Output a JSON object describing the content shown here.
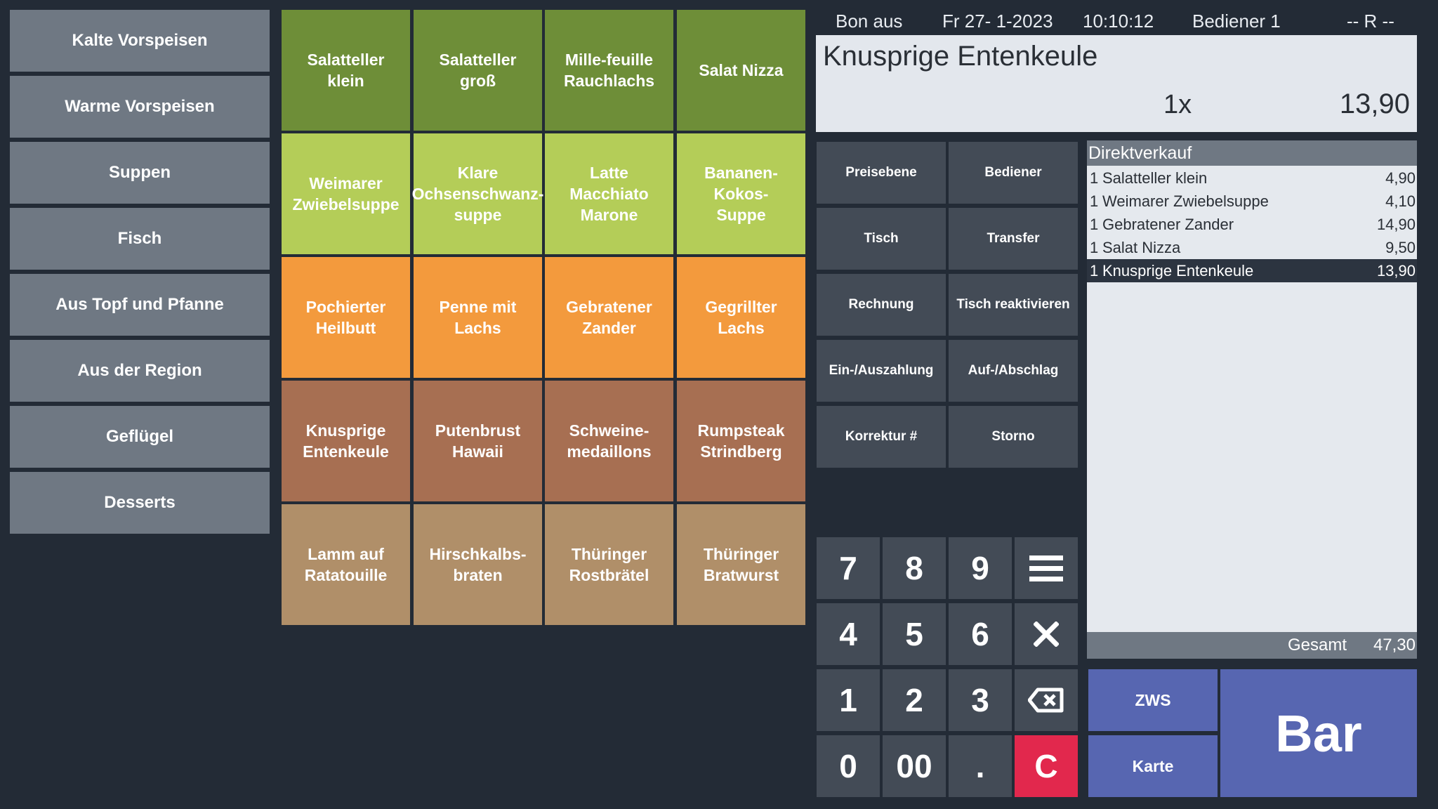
{
  "categories": [
    "Kalte Vorspeisen",
    "Warme Vorspeisen",
    "Suppen",
    "Fisch",
    "Aus Topf und Pfanne",
    "Aus der Region",
    "Geflügel",
    "Desserts"
  ],
  "products": [
    {
      "label": "Salatteller\nklein",
      "color": "#6e8e38"
    },
    {
      "label": "Salatteller\ngroß",
      "color": "#6e8e38"
    },
    {
      "label": "Mille-feuille\nRauchlachs",
      "color": "#6e8e38"
    },
    {
      "label": "Salat Nizza",
      "color": "#6e8e38"
    },
    {
      "label": "Weimarer\nZwiebelsuppe",
      "color": "#b4cd58"
    },
    {
      "label": "Klare\nOchsenschwanz-\nsuppe",
      "color": "#b4cd58"
    },
    {
      "label": "Latte\nMacchiato\nMarone",
      "color": "#b4cd58"
    },
    {
      "label": "Bananen-\nKokos-\nSuppe",
      "color": "#b4cd58"
    },
    {
      "label": "Pochierter\nHeilbutt",
      "color": "#f39a3d"
    },
    {
      "label": "Penne mit\nLachs",
      "color": "#f39a3d"
    },
    {
      "label": "Gebratener\nZander",
      "color": "#f39a3d"
    },
    {
      "label": "Gegrillter\nLachs",
      "color": "#f39a3d"
    },
    {
      "label": "Knusprige\nEntenkeule",
      "color": "#a76f52"
    },
    {
      "label": "Putenbrust\nHawaii",
      "color": "#a76f52"
    },
    {
      "label": "Schweine-\nmedaillons",
      "color": "#a76f52"
    },
    {
      "label": "Rumpsteak\nStrindberg",
      "color": "#a76f52"
    },
    {
      "label": "Lamm auf\nRatatouille",
      "color": "#b08f69"
    },
    {
      "label": "Hirschkalbs-\nbraten",
      "color": "#b08f69"
    },
    {
      "label": "Thüringer\nRostbrätel",
      "color": "#b08f69"
    },
    {
      "label": "Thüringer\nBratwurst",
      "color": "#b08f69"
    }
  ],
  "header": {
    "bon": "Bon aus",
    "date": "Fr  27- 1-2023",
    "time": "10:10:12",
    "operator": "Bediener 1",
    "mode": "-- R --"
  },
  "display": {
    "item": "Knusprige Entenkeule",
    "qty": "1x",
    "price": "13,90"
  },
  "functions": [
    "Preisebene",
    "Bediener",
    "Tisch",
    "Transfer",
    "Rechnung",
    "Tisch reaktivieren",
    "Ein-/Auszahlung",
    "Auf-/Abschlag",
    "Korrektur #",
    "Storno"
  ],
  "receipt": {
    "title": "Direktverkauf",
    "items": [
      {
        "qty": "1",
        "name": "Salatteller klein",
        "price": "4,90"
      },
      {
        "qty": "1",
        "name": "Weimarer Zwiebelsuppe",
        "price": "4,10"
      },
      {
        "qty": "1",
        "name": "Gebratener Zander",
        "price": "14,90"
      },
      {
        "qty": "1",
        "name": "Salat Nizza",
        "price": "9,50"
      },
      {
        "qty": "1",
        "name": "Knusprige Entenkeule",
        "price": "13,90"
      }
    ],
    "total_label": "Gesamt",
    "total": "47,30"
  },
  "keypad": [
    "7",
    "8",
    "9",
    "4",
    "5",
    "6",
    "1",
    "2",
    "3",
    "0",
    "00",
    "."
  ],
  "keypad_clear": "C",
  "payment": {
    "zws": "ZWS",
    "card": "Karte",
    "cash": "Bar"
  },
  "icons": {
    "menu": "menu-icon",
    "multiply": "multiply-icon",
    "backspace": "backspace-icon"
  },
  "colors": {
    "background": "#232b36",
    "category": "#6f7883",
    "function": "#434b56",
    "pay": "#5766b1",
    "clear": "#e2284d"
  }
}
